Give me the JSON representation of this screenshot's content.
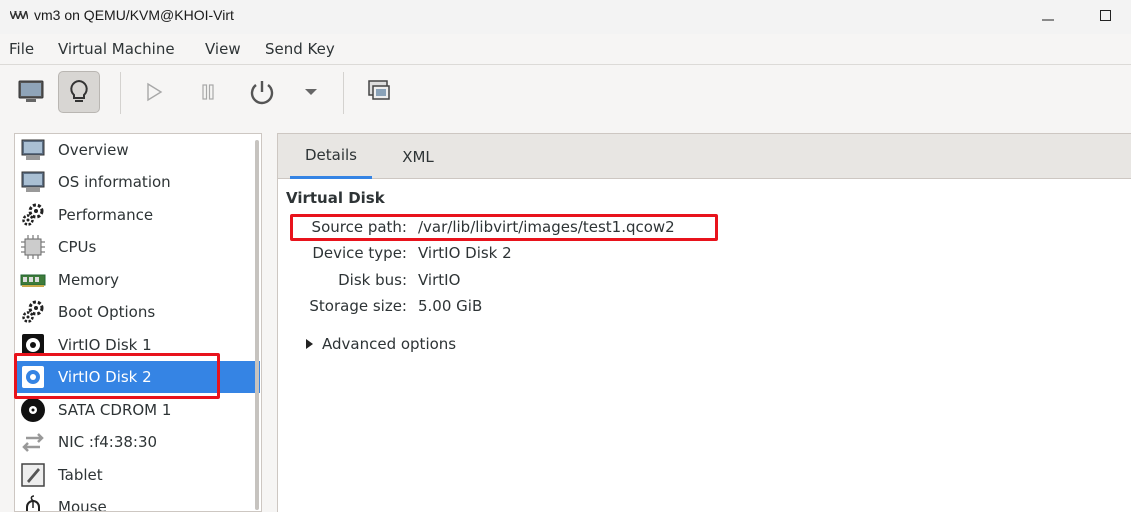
{
  "window": {
    "title": "vm3 on QEMU/KVM@KHOI-Virt"
  },
  "menu": [
    "File",
    "Virtual Machine",
    "View",
    "Send Key"
  ],
  "toolbar": {
    "buttons": [
      "console-icon",
      "details-icon",
      "run-icon",
      "pause-icon",
      "shutdown-icon",
      "dropdown-arrow-icon",
      "snapshots-icon"
    ]
  },
  "sidebar": {
    "items": [
      {
        "label": "Overview",
        "icon": "monitor-icon"
      },
      {
        "label": "OS information",
        "icon": "monitor-icon"
      },
      {
        "label": "Performance",
        "icon": "gears-icon"
      },
      {
        "label": "CPUs",
        "icon": "cpu-icon"
      },
      {
        "label": "Memory",
        "icon": "memory-icon"
      },
      {
        "label": "Boot Options",
        "icon": "gears-icon"
      },
      {
        "label": "VirtIO Disk 1",
        "icon": "disk-icon"
      },
      {
        "label": "VirtIO Disk 2",
        "icon": "disk-icon",
        "selected": true
      },
      {
        "label": "SATA CDROM 1",
        "icon": "cdrom-icon"
      },
      {
        "label": "NIC :f4:38:30",
        "icon": "network-icon"
      },
      {
        "label": "Tablet",
        "icon": "tablet-icon"
      },
      {
        "label": "Mouse",
        "icon": "mouse-icon"
      }
    ]
  },
  "tabs": [
    {
      "label": "Details",
      "active": true
    },
    {
      "label": "XML",
      "active": false
    }
  ],
  "details": {
    "section_title": "Virtual Disk",
    "fields": [
      {
        "label": "Source path:",
        "value": "/var/lib/libvirt/images/test1.qcow2"
      },
      {
        "label": "Device type:",
        "value": "VirtIO Disk 2"
      },
      {
        "label": "Disk bus:",
        "value": "VirtIO"
      },
      {
        "label": "Storage size:",
        "value": "5.00 GiB"
      }
    ],
    "advanced_label": "Advanced options"
  },
  "colors": {
    "selection": "#3584e4",
    "highlight_box": "#e8131c"
  }
}
